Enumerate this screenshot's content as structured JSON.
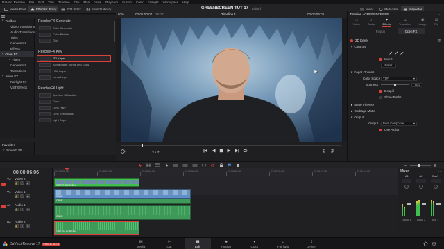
{
  "menu": [
    "DaVinci Resolve",
    "File",
    "Edit",
    "Trim",
    "Timeline",
    "Clip",
    "Mark",
    "View",
    "Playback",
    "Fusion",
    "Color",
    "Fairlight",
    "Workspace",
    "Help"
  ],
  "toolbar": {
    "left_buttons": [
      "Media Pool",
      "Effects Library",
      "Edit Index",
      "Sound Library"
    ],
    "project_title": "GREENSCREEN TUT 17",
    "project_status": "Edited",
    "right_buttons": [
      "Mixer",
      "Metadata",
      "Inspector"
    ]
  },
  "viewer_bar": {
    "zoom": "50%",
    "timecode_left": "00:01:00:07",
    "duration": "25:07",
    "timeline_name": "Timeline 1",
    "timecode_right": "00:00:06:06"
  },
  "tree": {
    "items": [
      {
        "label": "Toolbox",
        "level": 0,
        "selected": false
      },
      {
        "label": "Video Transitions",
        "level": 1,
        "selected": false
      },
      {
        "label": "Audio Transitions",
        "level": 1,
        "selected": false
      },
      {
        "label": "Titles",
        "level": 1,
        "selected": false
      },
      {
        "label": "Generators",
        "level": 1,
        "selected": false
      },
      {
        "label": "Effects",
        "level": 1,
        "selected": false
      },
      {
        "label": "Open FX",
        "level": 0,
        "selected": true
      },
      {
        "label": "Filters",
        "level": 1,
        "selected": false
      },
      {
        "label": "Generators",
        "level": 1,
        "selected": false
      },
      {
        "label": "Transitions",
        "level": 1,
        "selected": false
      },
      {
        "label": "Audio FX",
        "level": 0,
        "selected": false
      },
      {
        "label": "Fairlight FX",
        "level": 1,
        "selected": false
      },
      {
        "label": "VST Effects",
        "level": 1,
        "selected": false
      }
    ],
    "favorites_label": "Favorites",
    "favorites_item": "Smooth VF"
  },
  "fx_library": {
    "groups": [
      {
        "title": "ResolveFX Generate",
        "items": [
          "Color Generator",
          "Color Palette",
          "Grid"
        ]
      },
      {
        "title": "ResolveFX Key",
        "items": [
          "3D Keyer",
          "Alpha Matte Shrink and Grow",
          "HSL Keyer",
          "Luma Keyer"
        ]
      },
      {
        "title": "ResolveFX Light",
        "items": [
          "Aperture Diffraction",
          "Glow",
          "Lens Flare",
          "Lens Reflections",
          "Light Rays"
        ]
      }
    ],
    "selected_item": "3D Keyer"
  },
  "inspector": {
    "title": "Timeline - GREENSCREEN",
    "tabs": [
      "Video",
      "Audio",
      "Effects",
      "Transition",
      "Image",
      "File"
    ],
    "active_tab": "Effects",
    "subtabs": [
      "Fusion",
      "Open FX"
    ],
    "active_subtab": "Open FX",
    "effect_name": "3D Keyer",
    "sections": {
      "controls": "Controls",
      "invert": "Invert",
      "reset": "Reset",
      "keyer_options": "Keyer Options",
      "color_space": "Color Space",
      "color_space_value": "YUV",
      "softness": "Softness",
      "softness_value": "50.0",
      "despill": "Despill",
      "show_paths": "Show Paths",
      "matte_finesse": "Matte Finesse",
      "garbage_matte": "Garbage Matte",
      "output": "Output",
      "output_label": "Output",
      "output_value": "Final Composite",
      "use_alpha": "Use Alpha"
    }
  },
  "timeline": {
    "timecode": "00:00:06:06",
    "ruler_labels": [
      "01:00:00:00",
      "01:00:02:00",
      "01:00:04:00",
      "01:00:06:00",
      "01:00:08:00",
      "01:00:10:00",
      "01:00:12:00",
      "01:00:14:00",
      "01:00:16:00"
    ],
    "tracks": [
      {
        "id": "V2",
        "name": "Video 2"
      },
      {
        "id": "V1",
        "name": "Video 1"
      },
      {
        "id": "A1",
        "name": "Audio 1"
      },
      {
        "id": "A2",
        "name": "Audio 2"
      }
    ],
    "clips": {
      "v2": "GREENSCREEN",
      "v1": "CAVE",
      "a1_top": "CAVE",
      "a1_bottom": "CAVE",
      "a2": "GREEN SCREEN"
    }
  },
  "mixer": {
    "title": "Mixer",
    "channels": [
      "A1",
      "A2",
      "Bus1"
    ],
    "channel_labels": [
      "Audio 1",
      "Audio 2",
      "Bus 1"
    ]
  },
  "pagenav": {
    "app_name": "DaVinci Resolve 17",
    "badge": "PUBLIC BETA",
    "pages": [
      "Media",
      "Cut",
      "Edit",
      "Fusion",
      "Color",
      "Fairlight",
      "Deliver"
    ],
    "active_page": "Edit"
  },
  "colors": {
    "accent": "#d9413a",
    "v2_clip": "#3fbd4f",
    "v1_clip": "#5e8fc8",
    "audio_clip": "#3f9a59"
  }
}
